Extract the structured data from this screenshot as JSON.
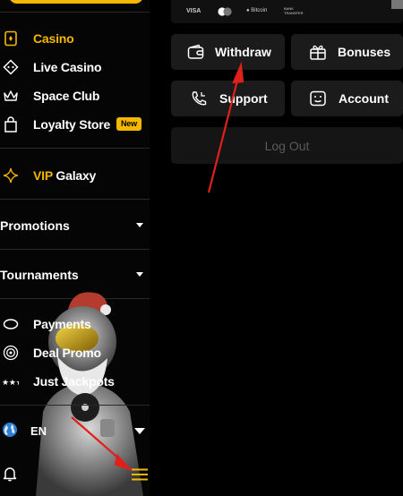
{
  "sidebar": {
    "items": [
      {
        "label": "Casino",
        "icon": "casino-icon",
        "active": true
      },
      {
        "label": "Live Casino",
        "icon": "live-casino-icon"
      },
      {
        "label": "Space Club",
        "icon": "crown-icon"
      },
      {
        "label": "Loyalty Store",
        "icon": "shopping-bag-icon",
        "badge": "New"
      }
    ],
    "vip": {
      "prefix": "VIP",
      "label": "Galaxy",
      "icon": "sparkle-icon"
    },
    "sections": [
      {
        "label": "Promotions"
      },
      {
        "label": "Tournaments"
      }
    ],
    "links": [
      {
        "label": "Payments",
        "icon": "coin-icon"
      },
      {
        "label": "Deal Promo",
        "icon": "target-icon"
      },
      {
        "label": "Just Jackpots",
        "icon": "stars-icon"
      }
    ],
    "language": {
      "code": "EN",
      "icon": "globe-icon"
    }
  },
  "main": {
    "payments_strip": {
      "visa": "VISA",
      "bitcoin": "Bitcoin",
      "other": "BANK TRANSFER"
    },
    "tiles": [
      {
        "label": "Withdraw",
        "icon": "wallet-icon"
      },
      {
        "label": "Bonuses",
        "icon": "gift-icon"
      },
      {
        "label": "Support",
        "icon": "phone-icon"
      },
      {
        "label": "Account",
        "icon": "account-icon"
      }
    ],
    "logout": "Log Out"
  },
  "colors": {
    "accent": "#f5b800",
    "background": "#000000",
    "tile": "#1b1b1b",
    "annotation_arrow": "#e0201b"
  }
}
